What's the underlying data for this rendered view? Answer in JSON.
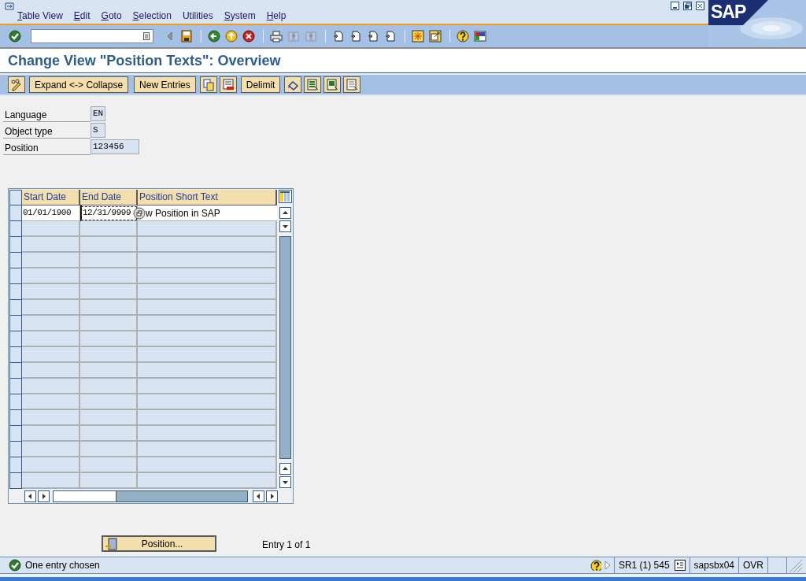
{
  "menu": [
    {
      "label": "Table View",
      "accelerator": true
    },
    {
      "label": "Edit",
      "accelerator": true
    },
    {
      "label": "Goto",
      "accelerator": true
    },
    {
      "label": "Selection",
      "accelerator": true
    },
    {
      "label": "Utilities",
      "accelerator": false
    },
    {
      "label": "System",
      "accelerator": true
    },
    {
      "label": "Help",
      "accelerator": true
    }
  ],
  "logo": "SAP",
  "title": "Change View \"Position Texts\": Overview",
  "app_toolbar": [
    {
      "kind": "icon"
    },
    {
      "kind": "text",
      "label": "Expand <-> Collapse"
    },
    {
      "kind": "text",
      "label": "New Entries"
    },
    {
      "kind": "icon"
    },
    {
      "kind": "icon"
    },
    {
      "kind": "text",
      "label": "Delimit"
    },
    {
      "kind": "icon"
    },
    {
      "kind": "icon"
    },
    {
      "kind": "icon"
    },
    {
      "kind": "icon"
    }
  ],
  "fields": [
    {
      "label": "Language",
      "value": "EN"
    },
    {
      "label": "Object type",
      "value": "S"
    },
    {
      "label": "Position",
      "value": "123456"
    }
  ],
  "table": {
    "columns": [
      "Start Date",
      "End Date",
      "Position Short Text"
    ],
    "rows": [
      {
        "cells": [
          {
            "text": "01/01/1900",
            "focused": false
          },
          {
            "text": "12/31/9999",
            "focused": true
          },
          {
            "text": "w Position in SAP",
            "focused": false
          }
        ]
      }
    ]
  },
  "position_button": "Position...",
  "entry_count": "Entry 1 of 1",
  "status_bar": {
    "message": "One entry chosen",
    "system": "SR1 (1) 545",
    "server": "sapsbx04",
    "mode": "OVR"
  }
}
